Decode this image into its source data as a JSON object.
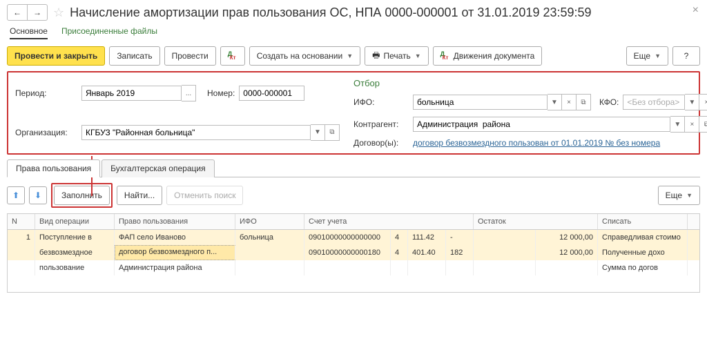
{
  "title": "Начисление амортизации прав пользования ОС, НПА 0000-000001 от 31.01.2019 23:59:59",
  "subnav": {
    "main": "Основное",
    "files": "Присоединенные файлы"
  },
  "toolbar": {
    "post_close": "Провести и закрыть",
    "save": "Записать",
    "post": "Провести",
    "create_based": "Создать на основании",
    "print": "Печать",
    "movements": "Движения документа",
    "more": "Еще",
    "help": "?"
  },
  "header": {
    "period_lbl": "Период:",
    "period_val": "Январь 2019",
    "number_lbl": "Номер:",
    "number_val": "0000-000001",
    "org_lbl": "Организация:",
    "org_val": "КГБУЗ \"Районная больница\""
  },
  "filter": {
    "title": "Отбор",
    "ifo_lbl": "ИФО:",
    "ifo_val": "больница",
    "kfo_lbl": "КФО:",
    "kfo_placeholder": "<Без отбора>",
    "contragent_lbl": "Контрагент:",
    "contragent_val": "Администрация  района",
    "contract_lbl": "Договор(ы):",
    "contract_link": "договор безвозмездного пользован от 01.01.2019 № без номера"
  },
  "tabs": {
    "t1": "Права пользования",
    "t2": "Бухгалтерская операция"
  },
  "tabToolbar": {
    "fill": "Заполнить",
    "find": "Найти...",
    "cancelFind": "Отменить поиск",
    "more": "Еще"
  },
  "gridHead": {
    "n": "N",
    "op": "Вид операции",
    "right": "Право пользования",
    "ifo": "ИФО",
    "account": "Счет учета",
    "balance": "Остаток",
    "write": "Списать"
  },
  "rows": [
    {
      "n": "1",
      "op": "Поступление в",
      "right": "ФАП село Иваново",
      "ifo": "больница",
      "acct": "09010000000000000",
      "c1": "4",
      "c2": "111.42",
      "c3": "-",
      "bal": "12 000,00",
      "write": "Справедливая стоимо"
    },
    {
      "n": "",
      "op": "безвозмездное",
      "right": "договор безвозмездного п...",
      "ifo": "",
      "acct": "09010000000000180",
      "c1": "4",
      "c2": "401.40",
      "c3": "182",
      "bal": "12 000,00",
      "write": "Полученные дохо"
    },
    {
      "n": "",
      "op": "пользование",
      "right": "Администрация  района",
      "ifo": "",
      "acct": "",
      "c1": "",
      "c2": "",
      "c3": "",
      "bal": "",
      "write": "Сумма по догов"
    }
  ],
  "icons": {
    "back": "←",
    "fwd": "→",
    "star": "☆",
    "close": "×",
    "caret": "▼",
    "ellipsis": "...",
    "x": "×",
    "expand": "⧉",
    "up": "⬆",
    "down": "⬇",
    "print": "🖶"
  }
}
